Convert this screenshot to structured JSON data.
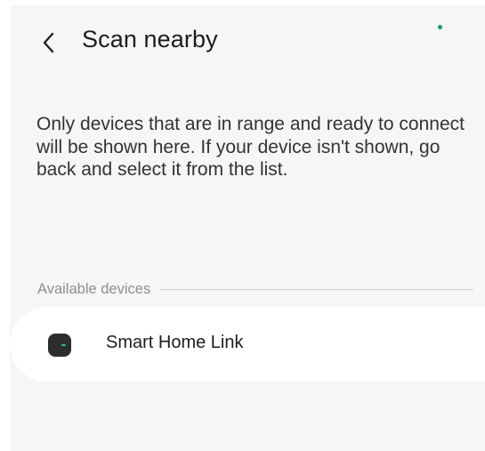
{
  "header": {
    "title": "Scan nearby",
    "back_icon": "chevron-left-icon",
    "indicator_color": "#1b9a6a"
  },
  "description": "Only devices that are in range and ready to connect will be shown here. If your device isn't shown, go back and select it from the list.",
  "section": {
    "label": "Available devices"
  },
  "devices": [
    {
      "name": "Smart Home Link",
      "icon": "smart-home-hub-icon",
      "icon_color": "#2d2d2d",
      "led_color": "#38c172"
    }
  ]
}
